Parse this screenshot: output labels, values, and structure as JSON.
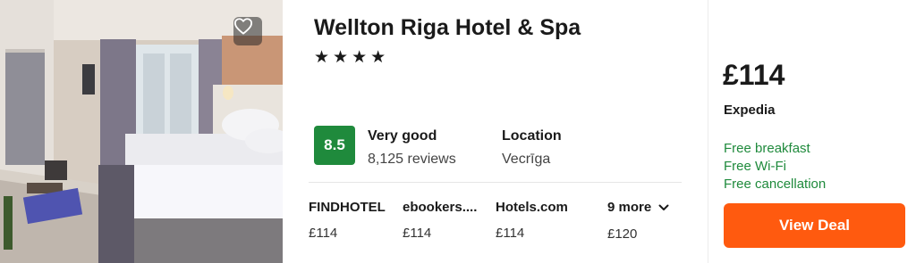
{
  "hotel": {
    "name": "Wellton Riga Hotel & Spa",
    "stars": "★★★★",
    "star_count": 4
  },
  "rating": {
    "score": "8.5",
    "label": "Very good",
    "reviews": "8,125 reviews"
  },
  "location": {
    "title": "Location",
    "value": "Vecrīga"
  },
  "providers": [
    {
      "name": "FINDHOTEL",
      "price": "£114"
    },
    {
      "name": "ebookers....",
      "price": "£114"
    },
    {
      "name": "Hotels.com",
      "price": "£114"
    }
  ],
  "more": {
    "label": "9 more",
    "price": "£120"
  },
  "deal": {
    "price": "£114",
    "provider": "Expedia",
    "perks": [
      "Free breakfast",
      "Free Wi-Fi",
      "Free cancellation"
    ],
    "button_label": "View Deal"
  },
  "colors": {
    "score_badge": "#1f8a3c",
    "perk_text": "#1f8a3c",
    "deal_button": "#ff5a0f"
  },
  "icons": {
    "favorite": "heart-outline-icon",
    "more": "chevron-down-icon"
  }
}
